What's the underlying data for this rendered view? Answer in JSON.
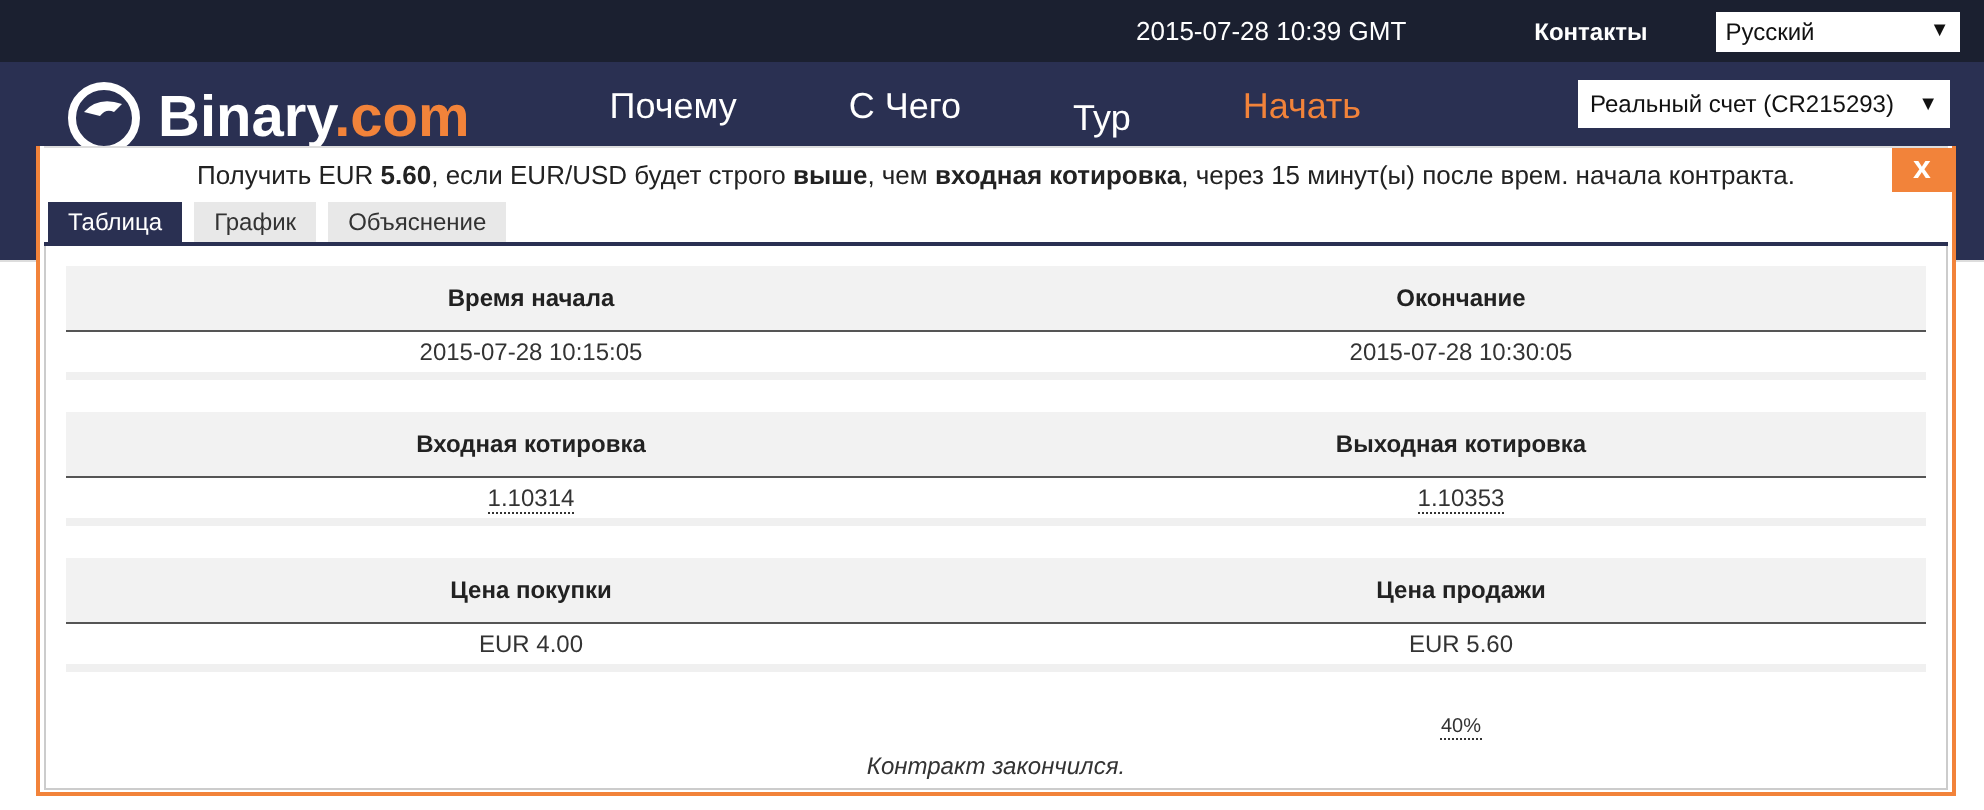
{
  "top_bar": {
    "datetime": "2015-07-28 10:39 GMT",
    "contacts": "Контакты",
    "language": {
      "value": "Русский",
      "arrow": "▼"
    }
  },
  "header": {
    "logo": {
      "name": "Binary",
      "suffix": ".com"
    },
    "nav": [
      {
        "label": "Почему",
        "highlighted": false
      },
      {
        "label": "С Чего",
        "highlighted": false
      },
      {
        "label": "Тур",
        "highlighted": false
      },
      {
        "label": "Начать",
        "highlighted": true
      }
    ],
    "account": {
      "value": "Реальный счет (CR215293)",
      "arrow": "▼"
    }
  },
  "dialog": {
    "title": "Получить EUR **5.60**, если EUR/USD будет строго **выше**, чем **входная котировка**, через 15 минут(ы) после врем. начала контракта.",
    "close": "x",
    "tabs": [
      {
        "label": "Таблица",
        "selected": true
      },
      {
        "label": "График",
        "selected": false
      },
      {
        "label": "Объяснение",
        "selected": false
      }
    ],
    "sections": [
      {
        "columns": [
          {
            "heading": "Время начала",
            "value": "2015-07-28 10:15:05",
            "underlined": false
          },
          {
            "heading": "Окончание",
            "value": "2015-07-28 10:30:05",
            "underlined": false
          }
        ]
      },
      {
        "columns": [
          {
            "heading": "Входная котировка",
            "value": "1.10314",
            "underlined": true
          },
          {
            "heading": "Выходная котировка",
            "value": "1.10353",
            "underlined": true
          }
        ]
      },
      {
        "columns": [
          {
            "heading": "Цена покупки",
            "value": "EUR 4.00",
            "underlined": false
          },
          {
            "heading": "Цена продажи",
            "value": "EUR 5.60",
            "underlined": false
          }
        ]
      }
    ],
    "profit": "40%",
    "status": "Контракт закончился."
  }
}
